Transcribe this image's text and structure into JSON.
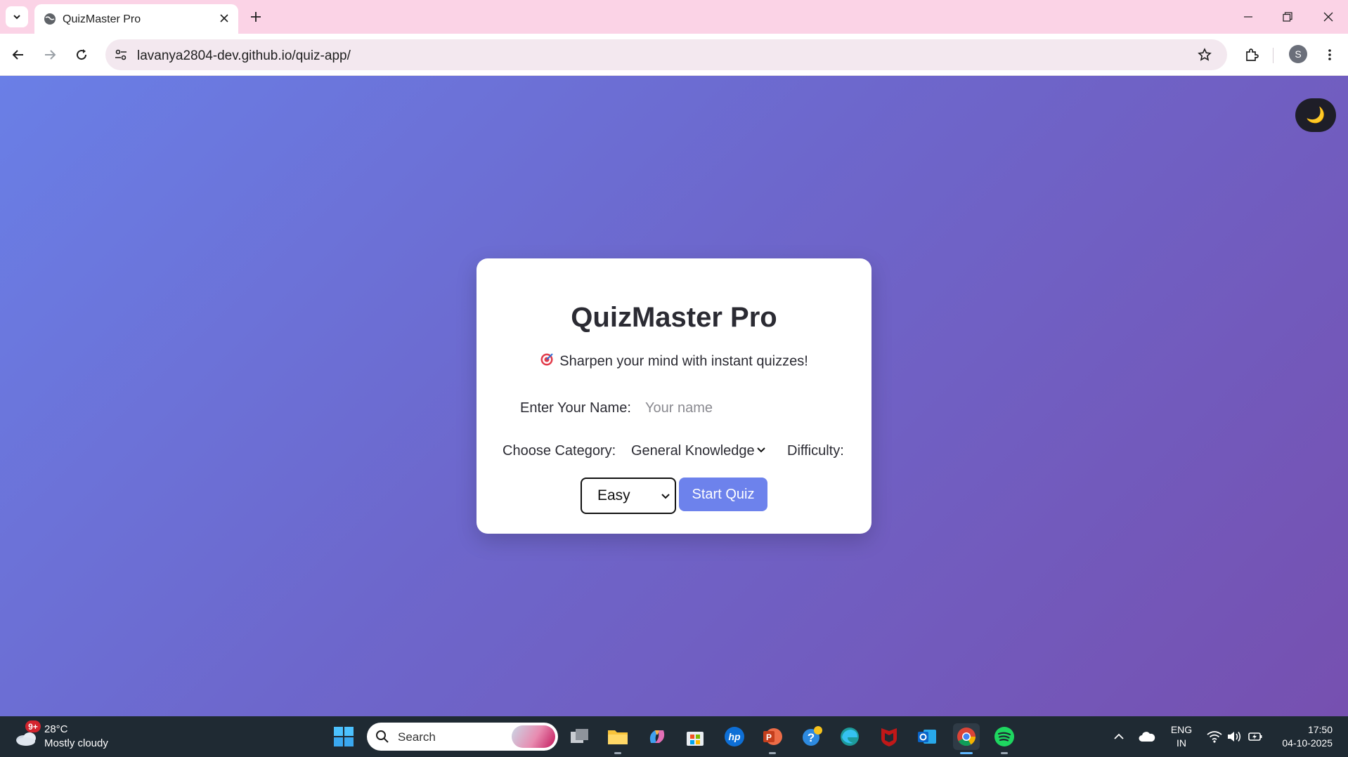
{
  "browser": {
    "tab_title": "QuizMaster Pro",
    "url": "lavanya2804-dev.github.io/quiz-app/",
    "profile_initial": "S"
  },
  "page": {
    "theme_toggle_icon": "🌙",
    "title": "QuizMaster Pro",
    "tagline": "Sharpen your mind with instant quizzes!",
    "name_label": "Enter Your Name:",
    "name_placeholder": "Your name",
    "name_value": "",
    "category_label": "Choose Category:",
    "category_selected": "General Knowledge",
    "difficulty_label": "Difficulty:",
    "difficulty_selected": "Easy",
    "start_button": "Start Quiz",
    "colors": {
      "gradient_start": "#6a7fe6",
      "gradient_end": "#7650b0",
      "button": "#6d82ec"
    }
  },
  "taskbar": {
    "weather_badge": "9+",
    "weather_temp": "28°C",
    "weather_desc": "Mostly cloudy",
    "search_label": "Search",
    "lang_line1": "ENG",
    "lang_line2": "IN",
    "time": "17:50",
    "date": "04-10-2025",
    "apps": [
      "start-menu",
      "task-view",
      "file-explorer",
      "copilot",
      "microsoft-store",
      "hp",
      "powerpoint",
      "help",
      "edge",
      "mcafee",
      "outlook",
      "chrome",
      "spotify"
    ]
  }
}
